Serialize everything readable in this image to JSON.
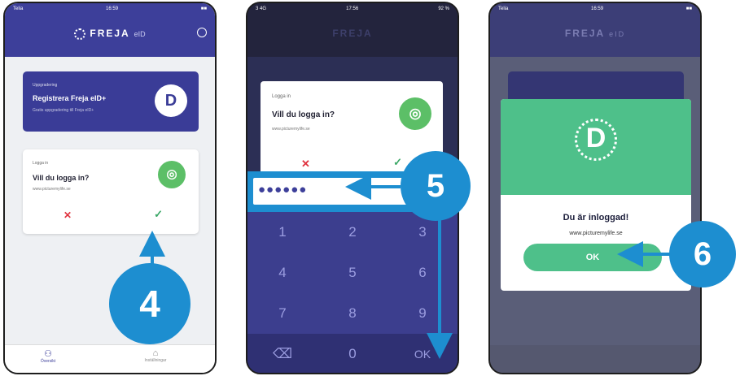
{
  "screen1": {
    "status": {
      "carrier": "Telia",
      "time": "16:59",
      "battery": "■■"
    },
    "header": {
      "logo": "FREJA",
      "logo_suffix": "eID"
    },
    "register_card": {
      "caption": "Uppgradering",
      "title": "Registrera Freja eID+",
      "subtitle": "Gratis uppgradering till Freja eID+"
    },
    "login_card": {
      "caption": "Logga in",
      "title": "Vill du logga in?",
      "url": "www.picturemylife.se",
      "reject": "✕",
      "accept": "✓"
    },
    "bottom_nav": [
      {
        "label": "Översikt",
        "icon": "⚇"
      },
      {
        "label": "Inställningar",
        "icon": "⌂"
      }
    ]
  },
  "screen2": {
    "status": {
      "carrier": "3 4G",
      "time": "17:56",
      "battery": "92 %"
    },
    "header": {
      "logo": "FREJA"
    },
    "login_card": {
      "caption": "Logga in",
      "title": "Vill du logga in?",
      "url": "www.picturemylife.se",
      "reject": "✕",
      "accept": "✓"
    },
    "pin": {
      "value": "●●●●●●"
    },
    "keypad": [
      "1",
      "2",
      "3",
      "4",
      "5",
      "6",
      "7",
      "8",
      "9",
      "⌫",
      "0",
      "OK"
    ]
  },
  "screen3": {
    "status": {
      "carrier": "Telia",
      "time": "16:59",
      "battery": "■■"
    },
    "header": {
      "logo": "FREJA",
      "logo_suffix": "eID"
    },
    "modal": {
      "logo_letter": "D",
      "title": "Du är inloggad!",
      "url": "www.picturemylife.se",
      "ok_label": "OK"
    }
  },
  "callouts": [
    "4",
    "5",
    "6"
  ],
  "colors": {
    "primary": "#3d3f9a",
    "accent": "#1d8ed0",
    "success": "#4ec08a",
    "danger": "#e0333f"
  }
}
